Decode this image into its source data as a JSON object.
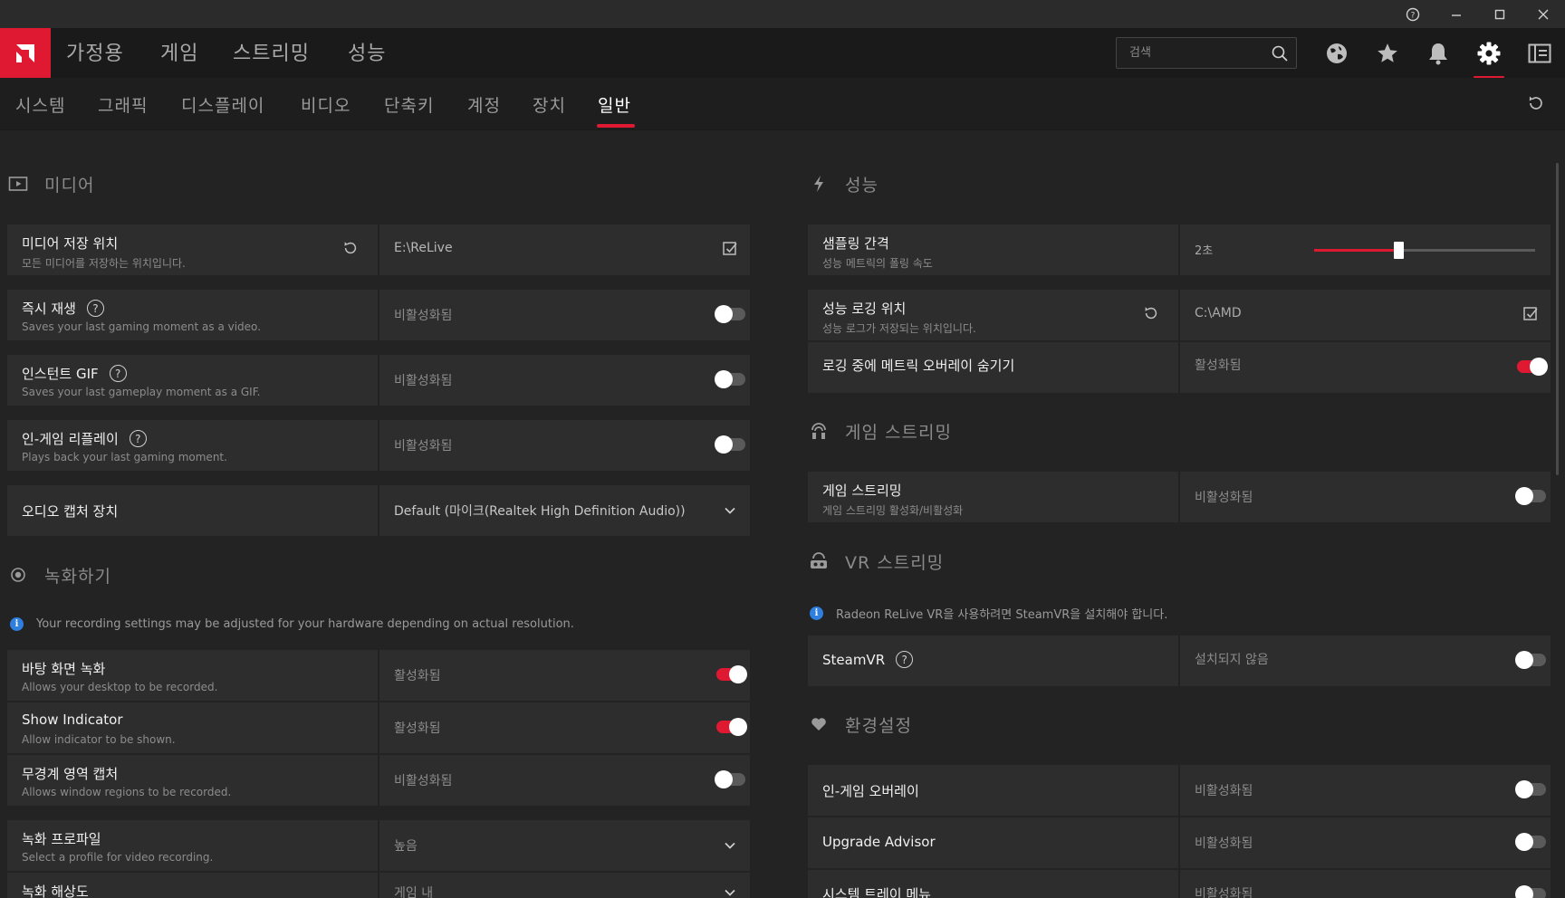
{
  "window": {
    "help_glyph": "?",
    "minimize_glyph": "—",
    "maximize_glyph": "☐",
    "close_glyph": "✕"
  },
  "main_nav": {
    "tabs": [
      "가정용",
      "게임",
      "스트리밍",
      "성능"
    ],
    "search_placeholder": "검색",
    "icons": [
      "globe-icon",
      "star-icon",
      "bell-icon",
      "gear-icon",
      "sidebar-icon"
    ],
    "active_icon": "gear-icon"
  },
  "sub_nav": {
    "tabs": [
      "시스템",
      "그래픽",
      "디스플레이",
      "비디오",
      "단축키",
      "계정",
      "장치",
      "일반"
    ],
    "active": "일반"
  },
  "accent_color": "#e01933",
  "left": {
    "media": {
      "title": "미디어",
      "rows": [
        {
          "title": "미디어 저장 위치",
          "desc": "모든 미디어를 저장하는 위치입니다.",
          "value": "E:\\ReLive"
        },
        {
          "title": "즉시 재생",
          "desc": "Saves your last gaming moment as a video.",
          "value": "비활성화됨",
          "toggle": "off"
        },
        {
          "title": "인스턴트 GIF",
          "desc": "Saves your last gameplay moment as a GIF.",
          "value": "비활성화됨",
          "toggle": "off"
        },
        {
          "title": "인-게임 리플레이",
          "desc": "Plays back your last gaming moment.",
          "value": "비활성화됨",
          "toggle": "off"
        },
        {
          "title": "오디오 캡처 장치",
          "value": "Default (마이크(Realtek High Definition Audio))"
        }
      ]
    },
    "recording": {
      "title": "녹화하기",
      "note": "Your recording settings may be adjusted for your hardware depending on actual resolution.",
      "rows": [
        {
          "title": "바탕 화면 녹화",
          "desc": "Allows your desktop to be recorded.",
          "value": "활성화됨",
          "toggle": "on"
        },
        {
          "title": "Show Indicator",
          "desc": "Allow indicator to be shown.",
          "value": "활성화됨",
          "toggle": "on"
        },
        {
          "title": "무경계 영역 캡처",
          "desc": "Allows window regions to be recorded.",
          "value": "비활성화됨",
          "toggle": "off"
        },
        {
          "title": "녹화 프로파일",
          "desc": "Select a profile for video recording.",
          "value": "높음"
        },
        {
          "title": "녹화 해상도",
          "value": "게임 내"
        }
      ]
    }
  },
  "right": {
    "performance": {
      "title": "성능",
      "rows": [
        {
          "title": "샘플링 간격",
          "desc": "성능 메트릭의 폴링 속도",
          "value": "2초",
          "slider_fraction": 0.38
        },
        {
          "title": "성능 로깅 위치",
          "desc": "성능 로그가 저장되는 위치입니다.",
          "value": "C:\\AMD"
        },
        {
          "title": "로깅 중에 메트릭 오버레이 숨기기",
          "value": "활성화됨",
          "toggle": "on"
        }
      ]
    },
    "game_streaming": {
      "title": "게임 스트리밍",
      "rows": [
        {
          "title": "게임 스트리밍",
          "desc": "게임 스트리밍 활성화/비활성화",
          "value": "비활성화됨",
          "toggle": "off"
        }
      ]
    },
    "vr_streaming": {
      "title": "VR 스트리밍",
      "note": "Radeon ReLive VR을 사용하려면 SteamVR을 설치해야 합니다.",
      "rows": [
        {
          "title": "SteamVR",
          "value": "설치되지 않음",
          "toggle": "off"
        }
      ]
    },
    "preferences": {
      "title": "환경설정",
      "rows": [
        {
          "title": "인-게임 오버레이",
          "value": "비활성화됨",
          "toggle": "off"
        },
        {
          "title": "Upgrade Advisor",
          "value": "비활성화됨",
          "toggle": "off"
        },
        {
          "title": "시스템 트레이 메뉴",
          "value": "비활성화됨",
          "toggle": "off"
        }
      ]
    }
  }
}
